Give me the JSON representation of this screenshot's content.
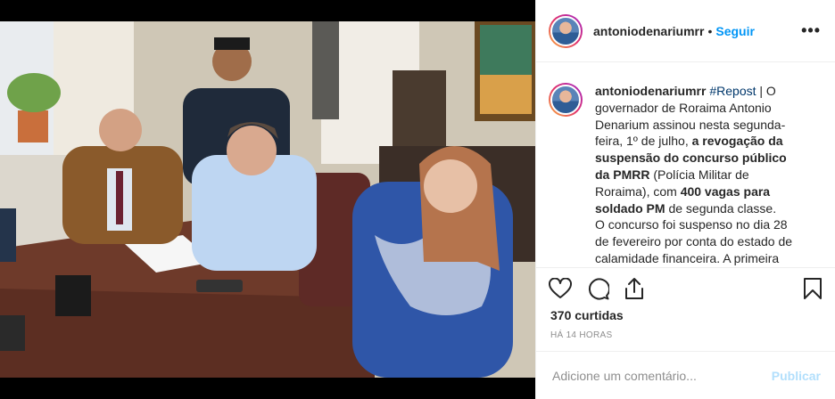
{
  "post": {
    "username": "antoniodenariumrr",
    "follow_label": "Seguir",
    "separator": "•",
    "more_label": "•••"
  },
  "caption": {
    "username": "antoniodenariumrr",
    "hashtag": "#Repost",
    "t1": " | O governador de Roraima Antonio Denarium assinou nesta segunda-feira, 1º de julho, ",
    "b1": "a revogação da suspensão do concurso público da PMRR",
    "t2": " (Polícia Militar de Roraima), com ",
    "b2": "400 vagas para soldado PM",
    "t3": " de segunda classe.",
    "t4": "O concurso foi suspenso no dia 28 de fevereiro por conta do estado de calamidade financeira. A primeira fase,"
  },
  "stats": {
    "likes": "370 curtidas",
    "time": "HÁ 14 HORAS"
  },
  "comment": {
    "placeholder": "Adicione um comentário...",
    "publish_label": "Publicar"
  },
  "icons": [
    "heart-icon",
    "comment-icon",
    "share-icon",
    "bookmark-icon"
  ],
  "colors": {
    "link": "#0095f6",
    "hashtag": "#00376b",
    "publish_disabled": "#b2dffc",
    "muted": "#8e8e8e"
  }
}
